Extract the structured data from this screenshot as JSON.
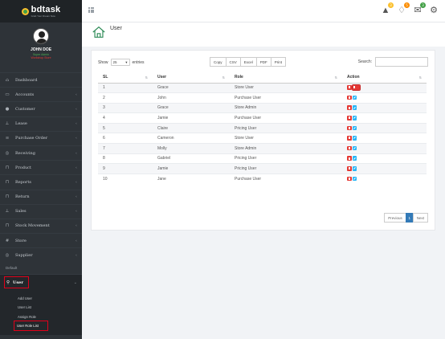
{
  "brand": {
    "name": "bdtask",
    "tagline": "Grab Your Dream Now"
  },
  "profile": {
    "name": "JOHN DOE",
    "status": "Super Admin",
    "store": "Workshop Store"
  },
  "sidebar": {
    "items": [
      {
        "label": "Dashboard",
        "icon": "home-icon",
        "chevron": ""
      },
      {
        "label": "Accounts",
        "icon": "wallet-icon",
        "chevron": "‹"
      },
      {
        "label": "Customer",
        "icon": "user-icon",
        "chevron": "‹"
      },
      {
        "label": "Lease",
        "icon": "lease-icon",
        "chevron": "‹"
      },
      {
        "label": "Purchase Order",
        "icon": "list-icon",
        "chevron": "‹"
      },
      {
        "label": "Receiving",
        "icon": "eye-icon",
        "chevron": "‹"
      },
      {
        "label": "Product",
        "icon": "box-icon",
        "chevron": "‹"
      },
      {
        "label": "Reports",
        "icon": "report-icon",
        "chevron": "‹"
      },
      {
        "label": "Return",
        "icon": "return-icon",
        "chevron": "‹"
      },
      {
        "label": "Sales",
        "icon": "sales-icon",
        "chevron": "‹"
      },
      {
        "label": "Stock Movement",
        "icon": "stock-icon",
        "chevron": "‹"
      },
      {
        "label": "Store",
        "icon": "store-icon",
        "chevron": "‹"
      },
      {
        "label": "Supplier",
        "icon": "supplier-icon",
        "chevron": "‹"
      }
    ],
    "section_header": "Default",
    "active_item": {
      "label": "User",
      "chevron": "⌄"
    },
    "sub_items": [
      "Add User",
      "User List",
      "Assign Role",
      "User Role List"
    ]
  },
  "topbar": {
    "badges": [
      "3",
      "5",
      "3"
    ]
  },
  "page": {
    "title": "User"
  },
  "controls": {
    "show_label": "Show",
    "entries_value": "25",
    "entries_label": "entries",
    "export_buttons": [
      "Copy",
      "CSV",
      "Excel",
      "PDF",
      "Print"
    ],
    "search_label": "Search:"
  },
  "table": {
    "headers": [
      "SL",
      "User",
      "Role",
      "Action"
    ],
    "rows": [
      [
        "1",
        "Grace",
        "Store User"
      ],
      [
        "2",
        "John",
        "Purchase User"
      ],
      [
        "3",
        "Grace",
        "Store Admin"
      ],
      [
        "4",
        "Jamie",
        "Purchase User"
      ],
      [
        "5",
        "Claire",
        "Pricing User"
      ],
      [
        "6",
        "Cameron",
        "Store User"
      ],
      [
        "7",
        "Molly",
        "Store Admin"
      ],
      [
        "8",
        "Gabriel",
        "Pricing User"
      ],
      [
        "9",
        "Jamie",
        "Pricing User"
      ],
      [
        "10",
        "Jane",
        "Purchase User"
      ]
    ]
  },
  "pagination": {
    "previous": "Previous",
    "current": "1",
    "next": "Next"
  },
  "colors": {
    "sidebar": "#2e3338",
    "accent_red": "#e0001a",
    "pager_active": "#337ab7"
  }
}
